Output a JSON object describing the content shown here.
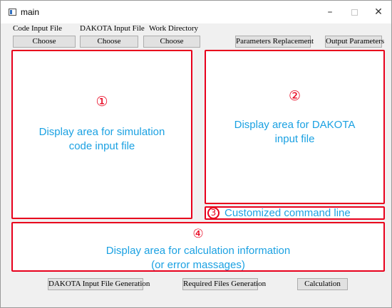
{
  "window": {
    "title": "main",
    "controls": {
      "minimize": "–",
      "close": "✕"
    }
  },
  "labels": {
    "code_input_file": "Code Input File",
    "dakota_input_file": "DAKOTA Input File",
    "work_directory": "Work Directory"
  },
  "toolbar": {
    "choose_code": "Choose",
    "choose_dakota": "Choose",
    "choose_workdir": "Choose",
    "parameters_replacement": "Parameters Replacement",
    "output_parameters": "Output Parameters"
  },
  "areas": {
    "code_input": {
      "number": "①",
      "line1": "Display area for simulation",
      "line2": "code input file"
    },
    "dakota_input": {
      "number": "②",
      "line1": "Display area for DAKOTA",
      "line2": "input file"
    },
    "command_line": {
      "number": "3",
      "text": "Customized command line"
    },
    "calc_info": {
      "number": "④",
      "line1": "Display area for calculation information",
      "line2": "(or error massages)"
    }
  },
  "bottom": {
    "dakota_generation": "DAKOTA Input File Generation",
    "required_files": "Required Files Generation",
    "calculation": "Calculation"
  },
  "colors": {
    "annotation_border": "#e8001c",
    "description_text": "#1ba1e2",
    "button_face": "#e1e1e1"
  }
}
